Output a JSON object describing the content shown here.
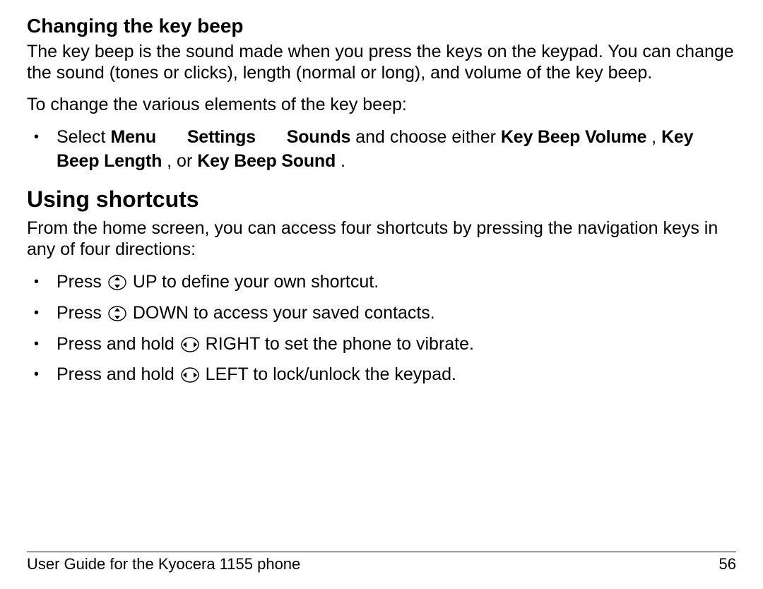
{
  "section1": {
    "title": "Changing the key beep",
    "para1": "The key beep is the sound made when you press the keys on the keypad. You can change the sound (tones or clicks), length (normal or long), and volume of the key beep.",
    "para2": "To change the various elements of the key beep:",
    "bullet": {
      "select": "Select",
      "menu": "Menu",
      "settings": "Settings",
      "sounds": "Sounds",
      "and_choose": " and choose either ",
      "kbv": "Key Beep Volume",
      "comma": ", ",
      "kbl": "Key Beep Length",
      "or": ", or ",
      "kbs": "Key Beep Sound",
      "period": "."
    }
  },
  "section2": {
    "title": "Using shortcuts",
    "para1": "From the home screen, you can access four shortcuts by pressing the navigation keys in any of four directions:",
    "items": [
      {
        "pre": "Press ",
        "post": " UP to define your own shortcut."
      },
      {
        "pre": "Press ",
        "post": " DOWN to access your saved contacts."
      },
      {
        "pre": "Press and hold ",
        "post": " RIGHT to set the phone to vibrate."
      },
      {
        "pre": "Press and hold ",
        "post": " LEFT to lock/unlock the keypad."
      }
    ]
  },
  "footer": {
    "left": "User Guide for the Kyocera 1155 phone",
    "right": "56"
  }
}
